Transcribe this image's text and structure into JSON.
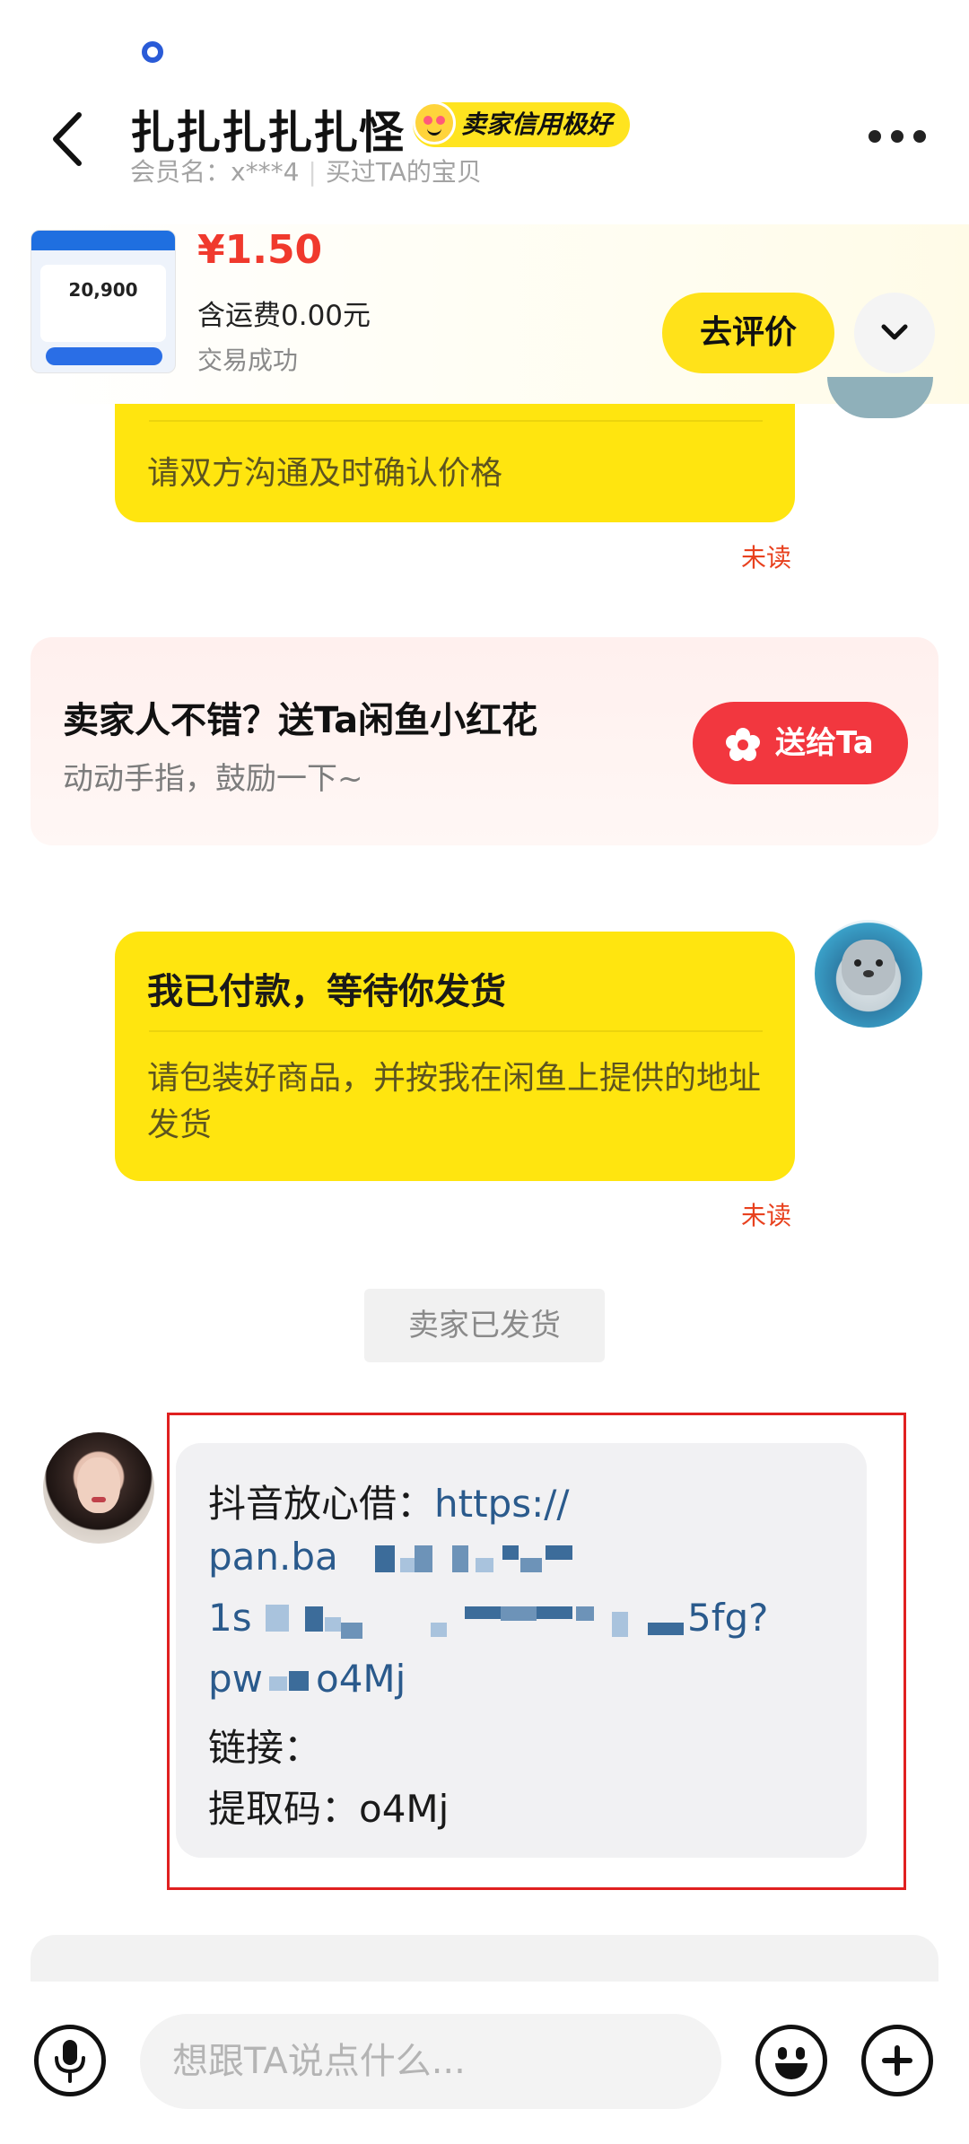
{
  "header": {
    "title": "扎扎扎扎扎怪",
    "credit_badge": "卖家信用极好",
    "member_name": "会员名：x***4",
    "bought_link": "买过TA的宝贝"
  },
  "product": {
    "price": "¥1.50",
    "shipping": "含运费0.00元",
    "status": "交易成功",
    "review_button": "去评价",
    "thumbnail_amount": "20,900"
  },
  "messages": {
    "bubble1_text": "请双方沟通及时确认价格",
    "bubble1_status": "未读",
    "flower_card": {
      "title": "卖家人不错？送Ta闲鱼小红花",
      "subtitle": "动动手指，鼓励一下~",
      "button": "送给Ta"
    },
    "bubble2": {
      "title": "我已付款，等待你发货",
      "text": "请包装好商品，并按我在闲鱼上提供的地址发货",
      "status": "未读"
    },
    "system_label": "卖家已发货",
    "seller_message": {
      "prefix": "抖音放心借：",
      "link_1": "https://",
      "link_2": "pan.ba",
      "link_3": "1s",
      "link_3b": "5fg?",
      "link_4a": "pw",
      "link_4b": "o4Mj",
      "link_label": "链接：",
      "code_line": "提取码：o4Mj"
    }
  },
  "input": {
    "placeholder": "想跟TA说点什么..."
  },
  "colors": {
    "accent_yellow": "#ffe50f",
    "price_red": "#f0392d",
    "flower_button": "#f2373f",
    "link_blue": "#2a5a8c",
    "highlight_red": "#e02020"
  }
}
